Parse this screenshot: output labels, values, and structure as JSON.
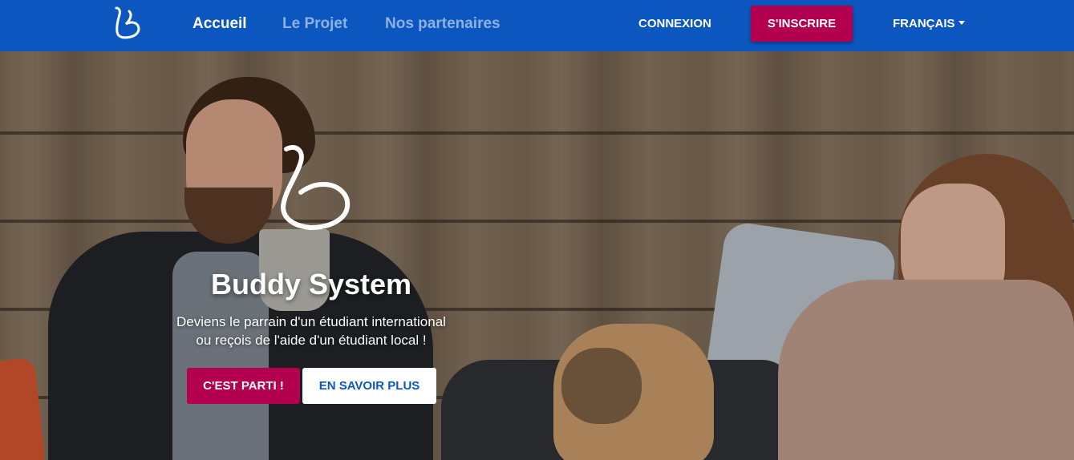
{
  "nav": {
    "links": [
      "Accueil",
      "Le Projet",
      "Nos partenaires"
    ],
    "login": "CONNEXION",
    "signup": "S'INSCRIRE",
    "language": "FRANÇAIS"
  },
  "hero": {
    "title": "Buddy System",
    "subtitle_line1": "Deviens le parrain d'un étudiant international",
    "subtitle_line2": "ou reçois de l'aide d'un étudiant local !",
    "primary_button": "C'EST PARTI !",
    "secondary_button": "EN SAVOIR PLUS"
  },
  "colors": {
    "navbar": "#0b57bf",
    "accent": "#b3004f",
    "nav_inactive": "#8fb0e3"
  }
}
